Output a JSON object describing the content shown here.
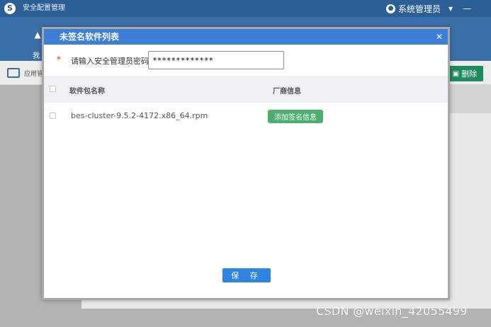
{
  "app": {
    "title": "安全配置管理",
    "logo_glyph": "S",
    "user_name": "系统管理员",
    "user_icon": "user-icon",
    "window_controls": {
      "menu": "▾",
      "minimize": "—"
    },
    "nav_partial_label": "我",
    "toolbar": {
      "partial_label": "应用管",
      "delete_label": "删除",
      "delete_icon": "trash-icon",
      "delete_color": "#1e8a5e"
    },
    "watermark": "CSDN @weixin_42055499"
  },
  "modal": {
    "title": "未签名软件列表",
    "close_icon": "close-icon",
    "header_color": "#3d7fd6",
    "password": {
      "required_mark": "*",
      "label": "请输入安全管理员密码:",
      "value": "*************"
    },
    "table": {
      "columns": [
        "软件包名称",
        "厂商信息"
      ],
      "rows": [
        {
          "name": "bes-cluster-9.5.2-4172.x86_64.rpm",
          "action_label": "添加签名信息"
        }
      ]
    },
    "save_label": "保 存",
    "save_color": "#2e86e0",
    "action_color": "#4caf6e"
  }
}
